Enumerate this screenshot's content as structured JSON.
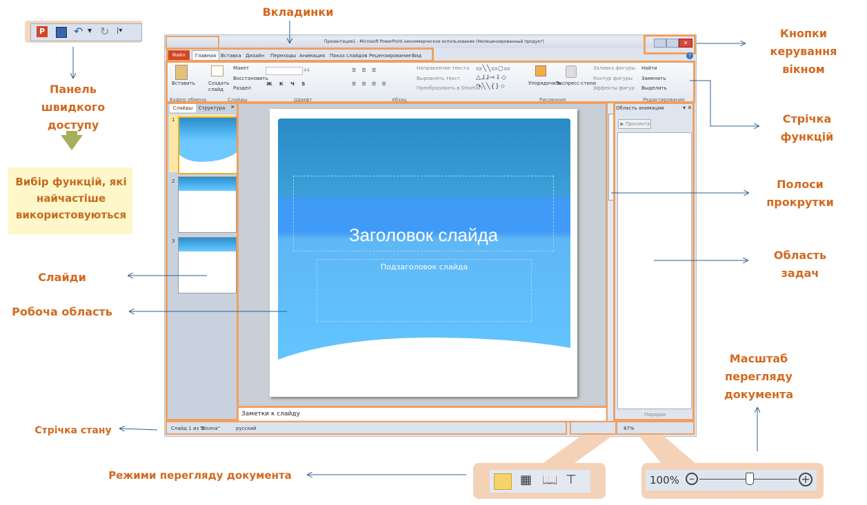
{
  "window": {
    "title": "Презентация1 - Microsoft PowerPoint некоммерческое использование (Нелицензированный продукт)",
    "tabs": [
      "Файл",
      "Главная",
      "Вставка",
      "Дизайн",
      "Переходы",
      "Анимация",
      "Показ слайдов",
      "Рецензирование",
      "Вид"
    ]
  },
  "ribbon": {
    "insert_label": "Вставить",
    "create_slide": "Создать слайд",
    "layout": "Макет",
    "restore": "Восстановить",
    "section": "Раздел",
    "font_size": "44",
    "text_direction": "Направление текста",
    "align_text": "Выровнять текст",
    "smartart": "Преобразовать в SmartArt",
    "arrange": "Упорядочить",
    "quick_styles": "Экспресс-стили",
    "fill": "Заливка фигуры",
    "outline": "Контур фигуры",
    "effects": "Эффекты фигур",
    "find": "Найти",
    "replace": "Заменить",
    "select": "Выделить",
    "groups": [
      "Буфер обмена",
      "Слайды",
      "Шрифт",
      "Абзац",
      "Рисование",
      "Редактирование"
    ]
  },
  "slides_panel": {
    "tab1": "Слайды",
    "tab2": "Структура",
    "nums": [
      "1",
      "2",
      "3"
    ]
  },
  "slide": {
    "title": "Заголовок слайда",
    "subtitle": "Подзаголовок слайда"
  },
  "notes": "Заметки к слайду",
  "task_pane": {
    "title": "Область анимации",
    "preview": "Просмотр",
    "order": "Порядок"
  },
  "status": {
    "slide": "Слайд 1 из 3",
    "theme": "\"Волна\"",
    "lang": "русский",
    "zoom": "87%"
  },
  "zoom_callout": {
    "value": "100%"
  },
  "labels": {
    "tabs": "Вкладинки",
    "window_buttons": "Кнопки керування вікном",
    "quick_access": "Панель швидкого доступу",
    "quick_note": "Вибір функцій, які найчастіше використовуються",
    "ribbon": "Стрічка функцій",
    "scrollbars": "Полоси прокрутки",
    "task_area": "Область задач",
    "slides": "Слайди",
    "work_area": "Робоча область",
    "status_bar": "Стрічка стану",
    "view_modes": "Режими перегляду документа",
    "zoom": "Масштаб перегляду документа"
  }
}
